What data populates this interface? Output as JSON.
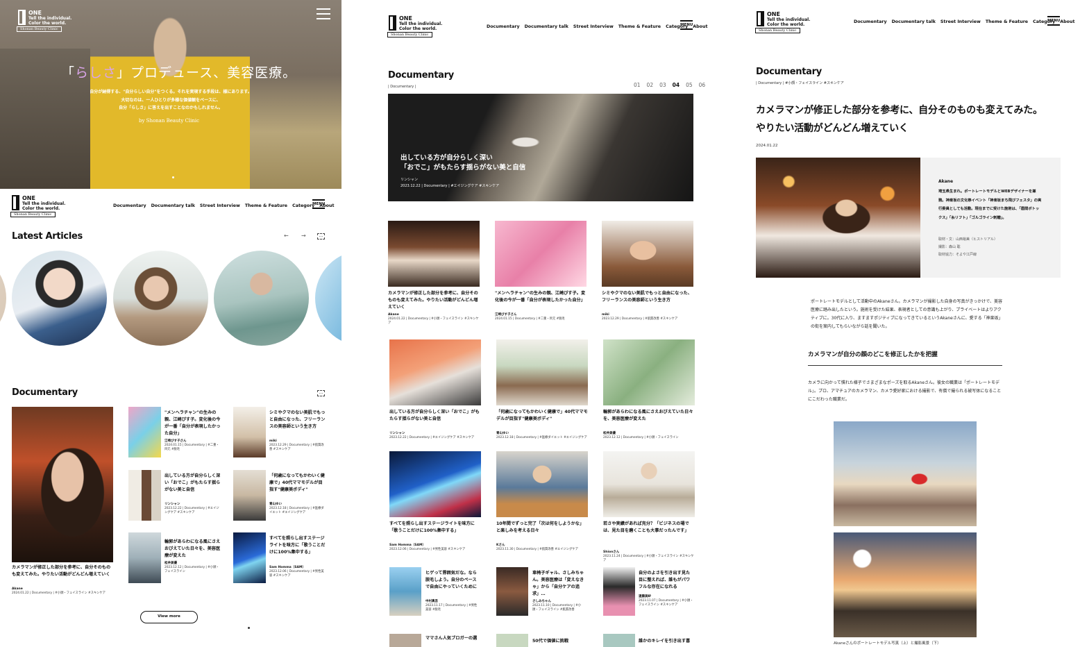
{
  "brand": {
    "name": "ONE",
    "tagline1": "Tell the individual.",
    "tagline2": "Color the world.",
    "clinic": "Shonan Beauty Clinic"
  },
  "nav": {
    "items": [
      "Documentary",
      "Documentary talk",
      "Street Interview",
      "Theme & Feature",
      "Category",
      "About"
    ],
    "menu": "MENU"
  },
  "hero": {
    "cat_pre": "「",
    "cat_accent": "らしさ",
    "cat_post": "」プロデュース、美容医療。",
    "desc_lines": [
      "自分が納得する、\"自分らしい自分\"をつくる。それを実現する手段は、様にあります。",
      "大切なのは、一人ひとりが多様な価値観をベースに、",
      "自分「らしさ」に答えを出すことなのかもしれません。"
    ],
    "by": "by Shonan Beauty Clinic"
  },
  "latest": {
    "title": "Latest Articles"
  },
  "documentary": {
    "title": "Documentary",
    "sub": "| Documentary |",
    "view_more": "View more",
    "feature": {
      "title": "カメラマンが修正した部分を参考に、自分そのものも変えてみた。やりたい活動がどんどん増えていく",
      "author": "Akane",
      "date": "2024.01.22",
      "tags": "| Documentary | #小顔・フェイスライン #スキンケア"
    },
    "cards": [
      {
        "title": "\"メンヘラチャン\"の生みの親、江崎びす子。変化後の今が一番「自分が表現したかった自分」",
        "author": "江崎びす子さん",
        "date": "2024.01.15",
        "tags": "| Documentary | #二重・目元 #脱毛"
      },
      {
        "title": "シミやクマのない美肌でもっと自由になった、フリーランスの美容師という生き方",
        "author": "miki",
        "date": "2023.12.29",
        "tags": "| Documentary | #肌質改善 #スキンケア"
      },
      {
        "title": "出している方が自分らしく深い「おでこ」がもたらす揺らがない美と自信",
        "author": "リンシャン",
        "date": "2023.12.22",
        "tags": "| Documentary | #エイジングケア #スキンケア"
      },
      {
        "title": "「何歳になってもかわいく健康で」40代ママモデルが目指す\"健康美ボディ\"",
        "author": "青山ゆい",
        "date": "2023.12.18",
        "tags": "| Documentary | #医療ダイエット #エイジングケア"
      },
      {
        "title": "輪郭があらわになる風にさえおびえていた日々を、美容医療が変えた",
        "author": "松井美優",
        "date": "2023.12.12",
        "tags": "| Documentary | #小顔・フェイスライン"
      },
      {
        "title": "すべてを照らし出すステージライトを味方に「歌うことだけに100%集中する」",
        "author": "Sam Homma（SAM）",
        "date": "2023.12.06",
        "tags": "| Documentary | #男性美容 #スキンケア"
      }
    ]
  },
  "listing": {
    "pages": [
      "01",
      "02",
      "03",
      "04",
      "05",
      "06"
    ],
    "active": "04",
    "hero": {
      "title_line1": "出している方が自分らしく深い",
      "title_line2": "「おでこ」がもたらす揺らがない美と自信",
      "author": "リンシャン",
      "date": "2023.12.22",
      "tags": "| Documentary | #エイジングケア #スキンケア"
    },
    "rows": [
      [
        {
          "title": "カメラマンが修正した部分を参考に、自分そのものも変えてみた。やりたい活動がどんどん増えていく",
          "author": "Akane",
          "meta": "2024.01.22 | Documentary | #小顔・フェイスライン #スキンケア"
        },
        {
          "title": "\"メンヘラチャン\"の生みの親、江崎びす子。変化後の今が一番「自分が表現したかった自分」",
          "author": "江崎びす子さん",
          "meta": "2024.01.15 | Documentary | #二重・目元 #脱毛"
        },
        {
          "title": "シミやクマのない美肌でもっと自由になった、フリーランスの美容師という生き方",
          "author": "miki",
          "meta": "2023.12.29 | Documentary | #肌質改善 #スキンケア"
        }
      ],
      [
        {
          "title": "出している方が自分らしく深い「おでこ」がもたらす揺らがない美と自信",
          "author": "リンシャン",
          "meta": "2023.12.22 | Documentary | #エイジングケア #スキンケア"
        },
        {
          "title": "「何歳になってもかわいく健康で」40代ママモデルが目指す\"健康美ボディ\"",
          "author": "青山ゆい",
          "meta": "2023.12.18 | Documentary | #医療ダイエット #エイジングケア"
        },
        {
          "title": "輪郭があらわになる風にさえおびえていた日々を、美容医療が変えた",
          "author": "松井美優",
          "meta": "2023.12.12 | Documentary | #小顔・フェイスライン"
        }
      ],
      [
        {
          "title": "すべてを照らし出すステージライトを味方に「歌うことだけに100%集中する」",
          "author": "Sam Homma（SAM）",
          "meta": "2023.12.06 | Documentary | #男性美容 #スキンケア"
        },
        {
          "title": "10年間でずっと完了「次は何をしようかな」と楽しみを考える日々",
          "author": "Kさん",
          "meta": "2023.11.30 | Documentary | #肌質改善 #エイジングケア"
        },
        {
          "title": "若さや実績があれば充分？「ビジネスの場では、見た目を磨くことも大事だったんです」",
          "author": "Shionさん",
          "meta": "2023.11.24 | Documentary | #小顔・フェイスライン #スキンケア"
        }
      ],
      [
        {
          "title": "ヒゲって雰囲気だな。なら脱毛しよう。自分のペースで自由にやっていくために",
          "author": "中村真吾",
          "meta": "2023.11.17 | Documentary | #男性美容 #脱毛"
        },
        {
          "title": "車椅子ギャル、さしみちゃん。美容医療は「変えなきゃ」から「自分ケアの追求」…",
          "author": "さしみちゃん",
          "meta": "2023.11.10 | Documentary | #小顔・フェイスライン #肌質改善"
        },
        {
          "title": "自分のよさを引き出す見た目に整えれば、誰もがパワフルな存在になれる",
          "author": "遠藤美紗",
          "meta": "2023.11.07 | Documentary | #小顔・フェイスライン #スキンケア"
        }
      ]
    ],
    "peek": [
      "ママさん人気ブロガーの選",
      "50代で価値に挑戦",
      "誰かのキレイを引き出す喜"
    ]
  },
  "article": {
    "cat": "Documentary",
    "breadcrumb": "| Documentary | #小顔・フェイスライン #スキンケア",
    "title_line1": "カメラマンが修正した部分を参考に、自分そのものも変えてみた。",
    "title_line2": "やりたい活動がどんどん増えていく",
    "date": "2024.01.22",
    "profile": {
      "name": "Akane",
      "bio": "埼玉県生まれ。ポートレートモデルとWEBデザイナーを兼務。神楽坂の文化祭イベント「神楽坂まち飛びフェスタ」の実行委員としても活動。現在までに受けた施術は、「眉間ボトックス」「糸リフト」「ゴルゴライン刺糖」。",
      "credit1": "取材・文：山西裕美（ヒストリアル）",
      "credit2": "撮影：森山 聡",
      "credit3": "取材協力：そよや江戸線"
    },
    "intro": "ポートレートモデルとして活動中のAkaneさん。カメラマンが撮影した自身の写真がきっかけで、美容医療に踏み出したという。施術を受けた結果、表現者としての意識も上がり、プライベートはよりアクティブに。30代に入り、ますますポジティブになってきているというAkaneさんに、愛する「神楽坂」の街を案内してもらいながら話を聞いた。",
    "section_title": "カメラマンが自分の顔のどこを修正したかを把握",
    "section_body": "カメラに向かって慣れた様子でさまざまなポーズを取るAkaneさん。彼女の職業は「ポートレートモデル」。プロ、アマチュアのカメラマン、カメラ愛好家における撮影で、有償で撮られる被写体になることにこだわった職業だ。",
    "photo_caption": "Akaneさんのポートレートモデル写真（上）と撮影風景（下）"
  }
}
